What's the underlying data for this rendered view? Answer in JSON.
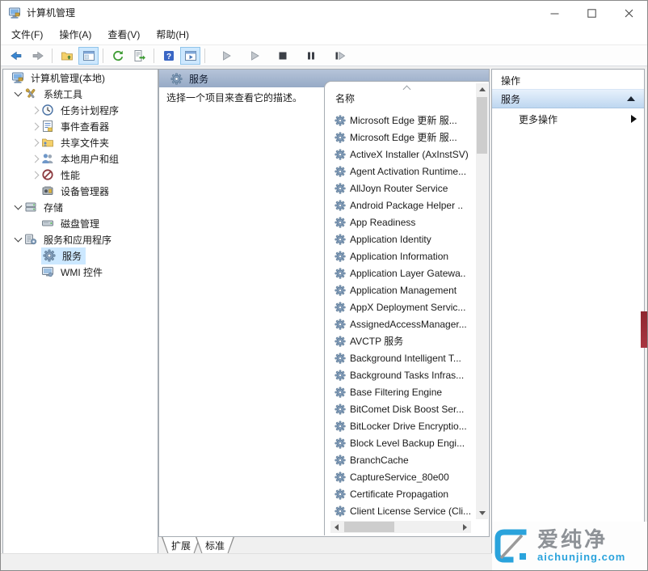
{
  "window": {
    "title": "计算机管理",
    "controls": [
      "minimize-icon",
      "maximize-icon",
      "close-icon"
    ]
  },
  "menu": {
    "items": [
      {
        "label": "文件(F)"
      },
      {
        "label": "操作(A)"
      },
      {
        "label": "查看(V)"
      },
      {
        "label": "帮助(H)"
      }
    ]
  },
  "toolbar": {
    "icons": [
      "back-icon",
      "forward-icon",
      "up-folder-icon",
      "console-tree-toggle-icon",
      "refresh-icon",
      "export-list-icon",
      "help-icon",
      "action-pane-toggle-icon",
      "start-service-icon",
      "resume-service-icon",
      "stop-service-icon",
      "pause-service-icon",
      "restart-service-icon"
    ]
  },
  "tree": {
    "items": [
      {
        "label": "计算机管理(本地)"
      },
      {
        "label": "系统工具"
      },
      {
        "label": "任务计划程序"
      },
      {
        "label": "事件查看器"
      },
      {
        "label": "共享文件夹"
      },
      {
        "label": "本地用户和组"
      },
      {
        "label": "性能"
      },
      {
        "label": "设备管理器"
      },
      {
        "label": "存储"
      },
      {
        "label": "磁盘管理"
      },
      {
        "label": "服务和应用程序"
      },
      {
        "label": "服务"
      },
      {
        "label": "WMI 控件"
      }
    ],
    "selected": "服务"
  },
  "center": {
    "header_title": "服务",
    "description": "选择一个项目来查看它的描述。",
    "list": {
      "column_header": "名称",
      "items": [
        "Microsoft Edge 更新 服...",
        "Microsoft Edge 更新 服...",
        "ActiveX Installer (AxInstSV)",
        "Agent Activation Runtime...",
        "AllJoyn Router Service",
        "Android Package Helper ..",
        "App Readiness",
        "Application Identity",
        "Application Information",
        "Application Layer Gatewa..",
        "Application Management",
        "AppX Deployment Servic...",
        "AssignedAccessManager...",
        "AVCTP 服务",
        "Background Intelligent T...",
        "Background Tasks Infras...",
        "Base Filtering Engine",
        "BitComet Disk Boost Ser...",
        "BitLocker Drive Encryptio...",
        "Block Level Backup Engi...",
        "BranchCache",
        "CaptureService_80e00",
        "Certificate Propagation",
        "Client License Service (Cli..."
      ]
    },
    "tabs": [
      {
        "label": "扩展"
      },
      {
        "label": "标准"
      }
    ]
  },
  "actions": {
    "panel_title": "操作",
    "section_title": "服务",
    "more_actions": "更多操作"
  },
  "watermark": {
    "name": "爱纯净",
    "domain": "aichunjing.com"
  },
  "colors": {
    "header_gradient_top": "#b6c4d9",
    "header_gradient_bottom": "#96aac6",
    "section_gradient_top": "#e7f1fc",
    "section_gradient_bottom": "#bed7f0",
    "tree_selection": "#cce8ff",
    "toolbar_selected_bg": "#cde8ff",
    "watermark_blue": "#2aa3dc",
    "watermark_gray": "#8e9297",
    "red_strip": "#8e2730"
  }
}
